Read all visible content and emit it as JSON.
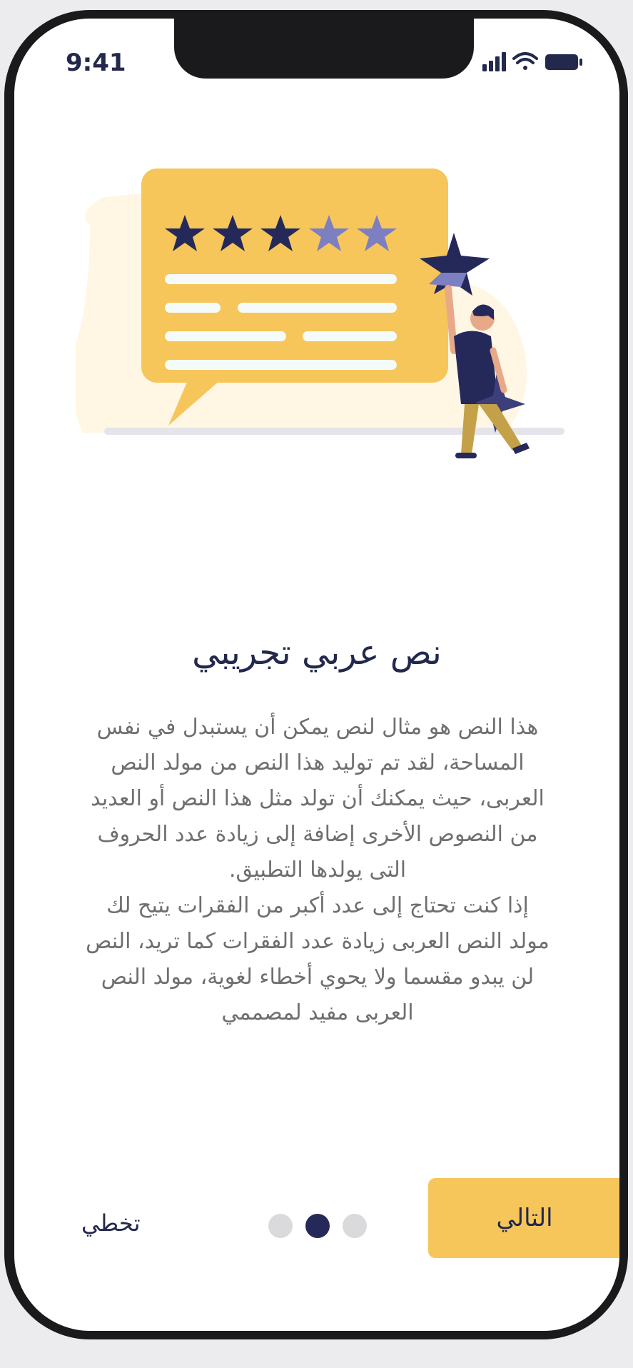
{
  "status_bar": {
    "time": "9:41",
    "icons": [
      "signal-icon",
      "wifi-icon",
      "battery-icon"
    ]
  },
  "illustration": {
    "icon": "rating-review-illustration",
    "rating": {
      "filled": 3,
      "total": 5
    }
  },
  "onboarding": {
    "title": "نص عربي تجريبي",
    "paragraph_1": "هذا النص هو مثال لنص يمكن أن يستبدل في نفس المساحة، لقد تم توليد هذا النص من مولد النص العربى، حيث يمكنك أن تولد مثل هذا النص أو العديد من النصوص الأخرى إضافة إلى زيادة عدد الحروف التى يولدها التطبيق.",
    "paragraph_2": "إذا كنت تحتاج إلى عدد أكبر من الفقرات يتيح لك مولد النص العربى زيادة عدد الفقرات كما تريد، النص لن يبدو مقسما ولا يحوي أخطاء لغوية، مولد النص العربى مفيد لمصممي"
  },
  "pagination": {
    "total": 3,
    "active_index": 1
  },
  "footer": {
    "skip_label": "تخطي",
    "next_label": "التالي"
  },
  "colors": {
    "accent": "#f6c65b",
    "navy": "#23284d",
    "body_text": "#6f6e70",
    "blob": "#fff6e3",
    "star_light": "#7c7fc0"
  }
}
